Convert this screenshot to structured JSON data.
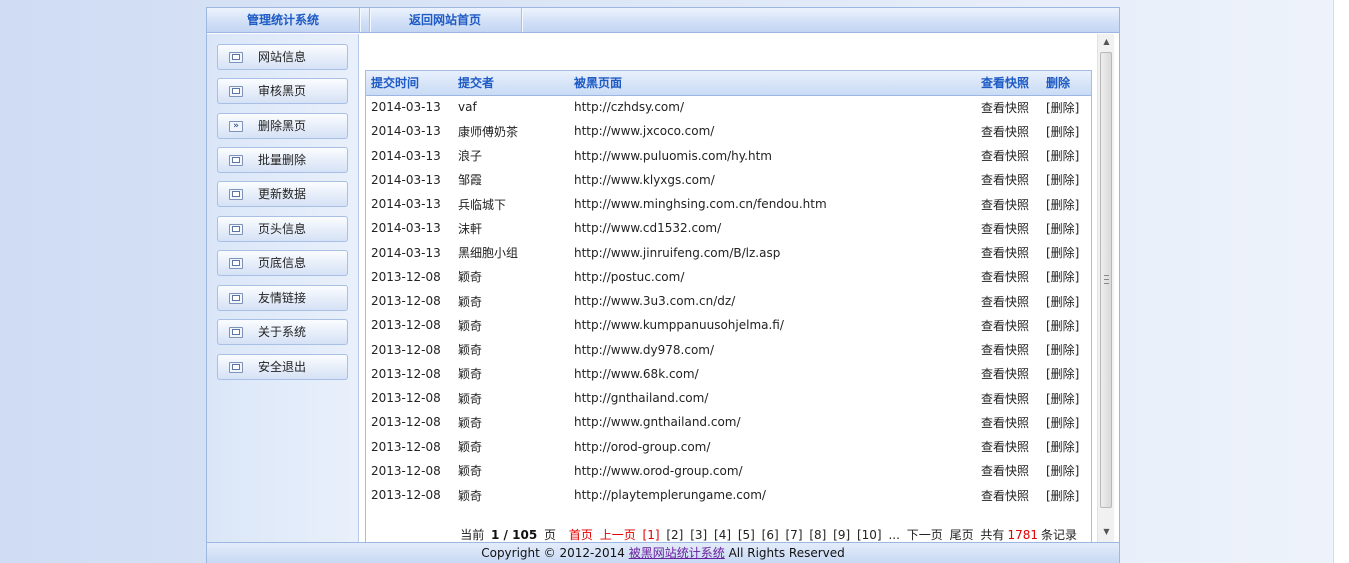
{
  "topbar": {
    "tab_system": "管理统计系统",
    "tab_home": "返回网站首页"
  },
  "sidebar": {
    "items": [
      {
        "label": "网站信息",
        "icon": "window-icon"
      },
      {
        "label": "审核黑页",
        "icon": "window-icon"
      },
      {
        "label": "删除黑页",
        "icon": "double-chevron-right-icon"
      },
      {
        "label": "批量删除",
        "icon": "window-icon"
      },
      {
        "label": "更新数据",
        "icon": "window-icon"
      },
      {
        "label": "页头信息",
        "icon": "window-icon"
      },
      {
        "label": "页底信息",
        "icon": "window-icon"
      },
      {
        "label": "友情链接",
        "icon": "window-icon"
      },
      {
        "label": "关于系统",
        "icon": "window-icon"
      },
      {
        "label": "安全退出",
        "icon": "window-icon"
      }
    ]
  },
  "table": {
    "headers": {
      "time": "提交时间",
      "submitter": "提交者",
      "page": "被黑页面",
      "snapshot": "查看快照",
      "delete": "删除"
    },
    "snapshot_label": "查看快照",
    "delete_label": "[删除]",
    "rows": [
      {
        "time": "2014-03-13",
        "submitter": "vaf",
        "url": "http://czhdsy.com/"
      },
      {
        "time": "2014-03-13",
        "submitter": "康师傅奶茶",
        "url": "http://www.jxcoco.com/"
      },
      {
        "time": "2014-03-13",
        "submitter": "浪子",
        "url": "http://www.puluomis.com/hy.htm"
      },
      {
        "time": "2014-03-13",
        "submitter": "邹霞",
        "url": "http://www.klyxgs.com/"
      },
      {
        "time": "2014-03-13",
        "submitter": "兵临城下",
        "url": "http://www.minghsing.com.cn/fendou.htm"
      },
      {
        "time": "2014-03-13",
        "submitter": "沫軒",
        "url": "http://www.cd1532.com/"
      },
      {
        "time": "2014-03-13",
        "submitter": "黑细胞小组",
        "url": "http://www.jinruifeng.com/B/lz.asp"
      },
      {
        "time": "2013-12-08",
        "submitter": "颖奇",
        "url": "http://postuc.com/"
      },
      {
        "time": "2013-12-08",
        "submitter": "颖奇",
        "url": "http://www.3u3.com.cn/dz/"
      },
      {
        "time": "2013-12-08",
        "submitter": "颖奇",
        "url": "http://www.kumppanuusohjelma.fi/"
      },
      {
        "time": "2013-12-08",
        "submitter": "颖奇",
        "url": "http://www.dy978.com/"
      },
      {
        "time": "2013-12-08",
        "submitter": "颖奇",
        "url": "http://www.68k.com/"
      },
      {
        "time": "2013-12-08",
        "submitter": "颖奇",
        "url": "http://gnthailand.com/"
      },
      {
        "time": "2013-12-08",
        "submitter": "颖奇",
        "url": "http://www.gnthailand.com/"
      },
      {
        "time": "2013-12-08",
        "submitter": "颖奇",
        "url": "http://orod-group.com/"
      },
      {
        "time": "2013-12-08",
        "submitter": "颖奇",
        "url": "http://www.orod-group.com/"
      },
      {
        "time": "2013-12-08",
        "submitter": "颖奇",
        "url": "http://playtemplerungame.com/"
      }
    ]
  },
  "pager": {
    "current_label": "当前",
    "page_of": "1 / 105",
    "page_suffix": "页",
    "first": "首页",
    "prev": "上一页",
    "pages": [
      "[1]",
      "[2]",
      "[3]",
      "[4]",
      "[5]",
      "[6]",
      "[7]",
      "[8]",
      "[9]",
      "[10]"
    ],
    "ellipsis": "...",
    "next": "下一页",
    "last": "尾页",
    "total_prefix": "共有",
    "total": "1781",
    "total_suffix": "条记录"
  },
  "footer": {
    "copyright": "Copyright © 2012-2014",
    "link": "被黑网站统计系统",
    "rights": "All Rights Reserved"
  },
  "colors": {
    "accent": "#1f5bc4",
    "highlight": "#e00000",
    "border": "#9db7e2"
  }
}
